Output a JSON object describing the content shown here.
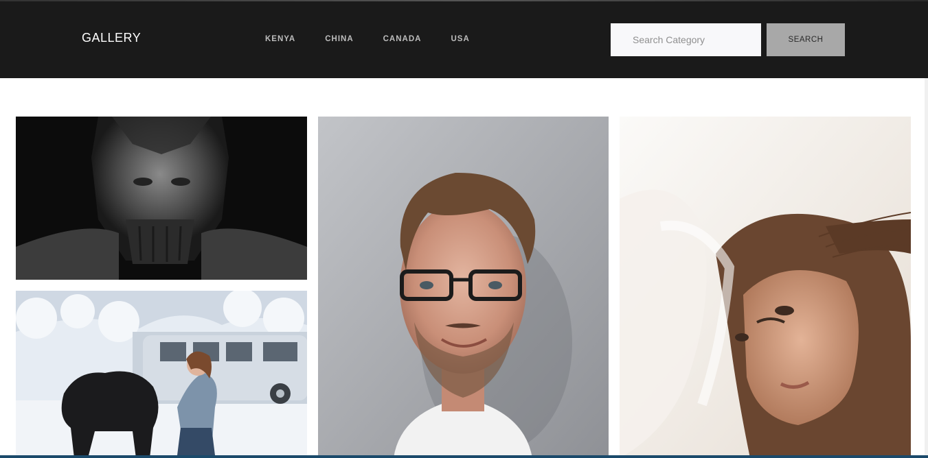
{
  "header": {
    "brand": "GALLERY",
    "nav": [
      "KENYA",
      "CHINA",
      "CANADA",
      "USA"
    ],
    "search": {
      "placeholder": "Search Category",
      "button_label": "SEARCH"
    }
  },
  "colors": {
    "header_bg": "#1a1a1a",
    "search_button_bg": "#a8a8a8",
    "nav_text": "#bdbdbd"
  }
}
